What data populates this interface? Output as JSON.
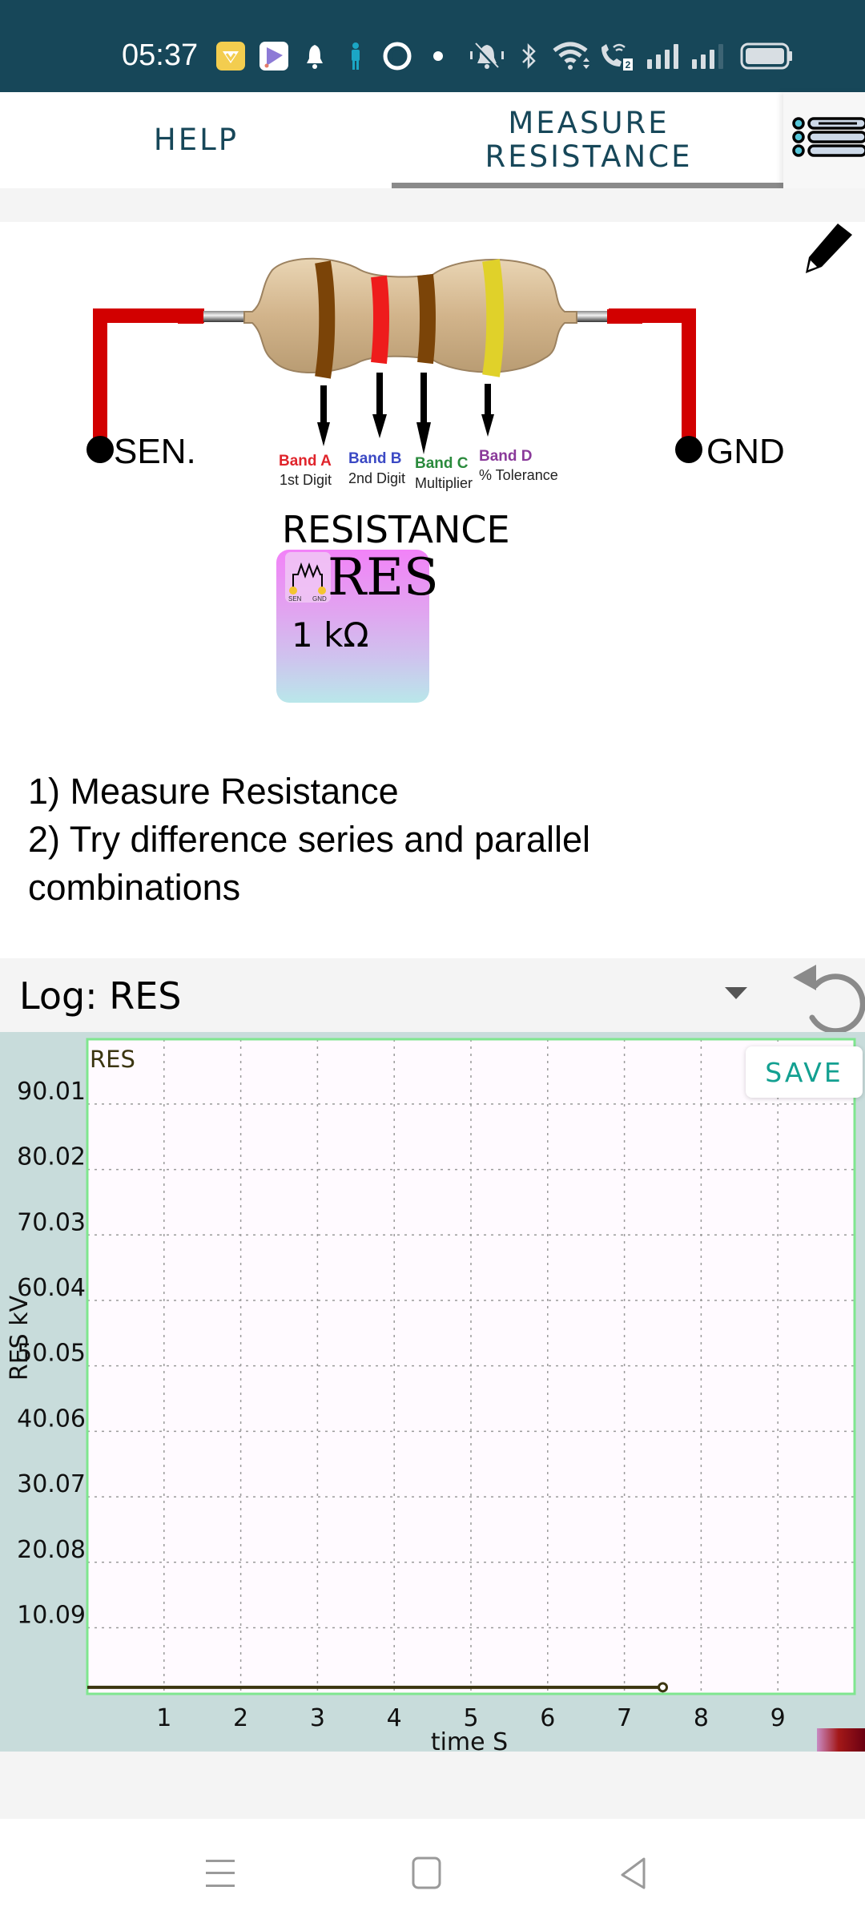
{
  "status_bar": {
    "time": "05:37",
    "icons": [
      "app-notification-v-icon",
      "app-notification-kite-icon",
      "bell-icon",
      "person-icon",
      "ring-app-icon",
      "dot-icon",
      "vibrate-mute-icon",
      "bluetooth-icon",
      "wifi-icon",
      "wifi-calling-icon",
      "signal-sim1-icon",
      "signal-sim2-icon",
      "battery-icon"
    ],
    "wifi_call_badge": "2"
  },
  "tabs": [
    {
      "label": "HELP",
      "selected": false
    },
    {
      "label": "MEASURE\nRESISTANCE",
      "line1": "MEASURE",
      "line2": "RESISTANCE",
      "selected": true
    }
  ],
  "menu_icon": "list-menu-icon",
  "edit_icon": "pencil-icon",
  "diagram": {
    "left_terminal": "SEN.",
    "right_terminal": "GND",
    "bands": [
      {
        "title": "Band A",
        "subtitle": "1st Digit",
        "color": "#e0242b",
        "band_color": "#7b4408"
      },
      {
        "title": "Band B",
        "subtitle": "2nd Digit",
        "color": "#3b49c4",
        "band_color": "#ee1c1c"
      },
      {
        "title": "Band C",
        "subtitle": "Multiplier",
        "color": "#2a8a3c",
        "band_color": "#7b4408"
      },
      {
        "title": "Band D",
        "subtitle": "% Tolerance",
        "color": "#8a3a9a",
        "band_color": "#e0d12a"
      }
    ]
  },
  "sensor": {
    "title": "RESISTANCE",
    "name": "RES",
    "value": "1 kΩ",
    "icon_labels": {
      "left": "SEN",
      "right": "GND"
    }
  },
  "instructions": [
    "1) Measure  Resistance",
    "2) Try difference series and parallel combinations"
  ],
  "log": {
    "label": "Log: RES",
    "refresh_icon": "refresh-icon",
    "save_label": "SAVE"
  },
  "chart_data": {
    "type": "line",
    "legend": "RES",
    "legend_position": "top-left",
    "xlabel": "time S",
    "ylabel": "RES kV",
    "x_ticks": [
      1,
      2,
      3,
      4,
      5,
      6,
      7,
      8,
      9
    ],
    "y_ticks": [
      "10.09",
      "20.08",
      "30.07",
      "40.06",
      "50.05",
      "60.04",
      "70.03",
      "80.02",
      "90.01"
    ],
    "y_tick_values": [
      10.09,
      20.08,
      30.07,
      40.06,
      50.05,
      60.04,
      70.03,
      80.02,
      90.01
    ],
    "xlim": [
      0,
      10
    ],
    "ylim": [
      0,
      99.9
    ],
    "grid": true,
    "series": [
      {
        "name": "RES",
        "color": "#3b3510",
        "x": [
          0,
          7.5
        ],
        "y": [
          1,
          1
        ]
      }
    ],
    "colors": {
      "plot_bg": "#fffaff",
      "panel_bg": "#c8dcdb",
      "border": "#7fe68f",
      "grid": "#9a9a9a"
    }
  },
  "nav_bar": {
    "buttons": [
      "recent-apps-icon",
      "home-icon",
      "back-icon"
    ]
  }
}
